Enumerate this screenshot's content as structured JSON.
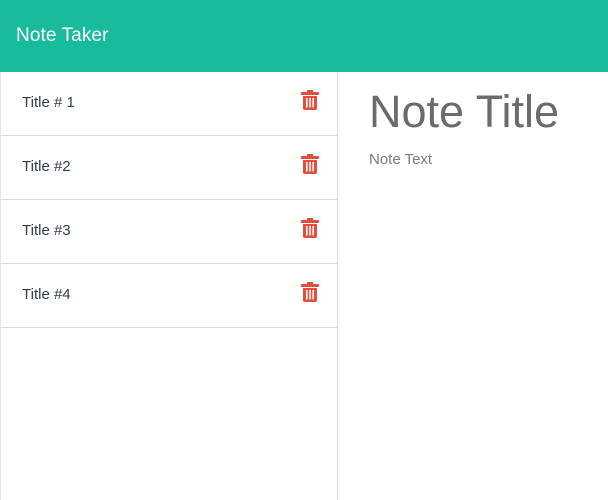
{
  "app": {
    "brand": "Note Taker",
    "accent_color": "#18bc9c",
    "delete_color": "#e74c3c"
  },
  "notes": [
    {
      "title": "Title # 1",
      "delete_icon": "trash-icon"
    },
    {
      "title": "Title #2",
      "delete_icon": "trash-icon"
    },
    {
      "title": "Title #3",
      "delete_icon": "trash-icon"
    },
    {
      "title": "Title #4",
      "delete_icon": "trash-icon"
    }
  ],
  "editor": {
    "title_placeholder": "Note Title",
    "text_placeholder": "Note Text"
  }
}
